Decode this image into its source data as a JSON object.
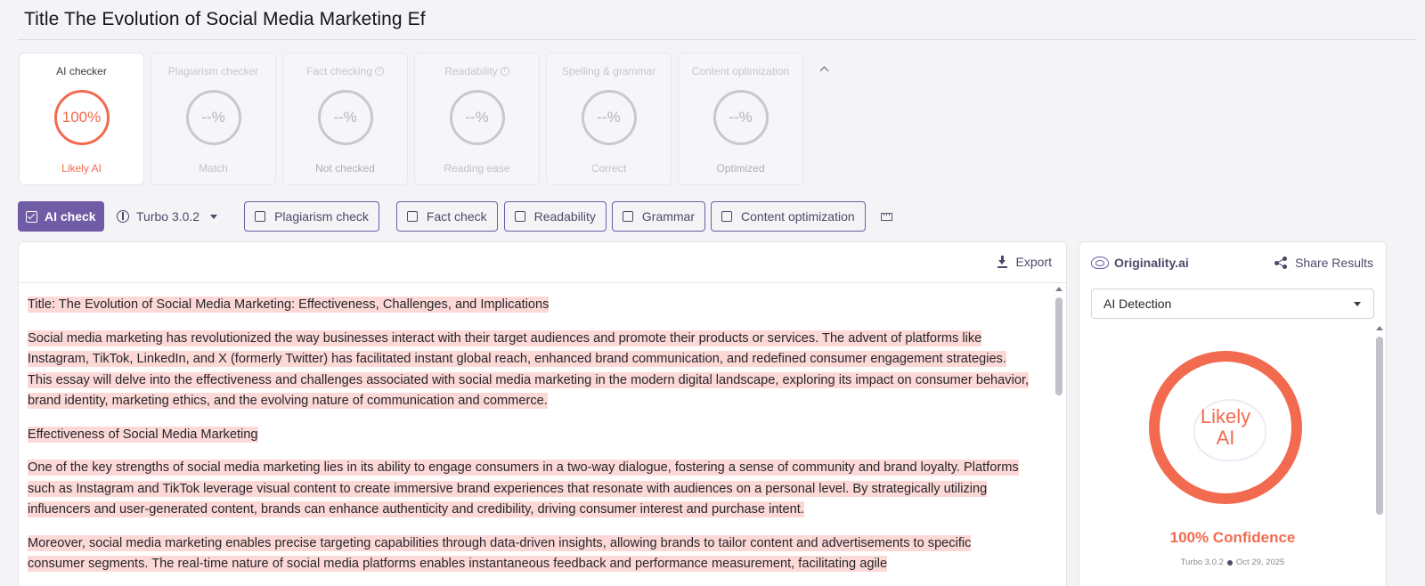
{
  "document": {
    "title": "Title The Evolution of Social Media Marketing Ef"
  },
  "cards": [
    {
      "title": "AI checker",
      "value": "100%",
      "sub": "Likely AI",
      "active": true
    },
    {
      "title": "Plagiarism checker",
      "value": "--%",
      "sub": "Match"
    },
    {
      "title": "Fact checking",
      "value": "--%",
      "sub": "Not checked"
    },
    {
      "title": "Readability",
      "value": "--%",
      "sub": "Reading ease"
    },
    {
      "title": "Spelling & grammar",
      "value": "--%",
      "sub": "Correct"
    },
    {
      "title": "Content optimization",
      "value": "--%",
      "sub": "Optimized"
    }
  ],
  "toolbar": {
    "ai_check": "AI check",
    "model": "Turbo 3.0.2",
    "plagiarism": "Plagiarism check",
    "fact": "Fact check",
    "readability": "Readability",
    "grammar": "Grammar",
    "content_opt": "Content optimization"
  },
  "text_panel": {
    "export": "Export",
    "paragraphs": [
      "Title: The Evolution of Social Media Marketing: Effectiveness, Challenges, and Implications",
      "Social media marketing has revolutionized the way businesses interact with their target audiences and promote their products or services. The advent of platforms like Instagram, TikTok, LinkedIn, and X (formerly Twitter) has facilitated instant global reach, enhanced brand communication, and redefined consumer engagement strategies. This essay will delve into the effectiveness and challenges associated with social media marketing in the modern digital landscape, exploring its impact on consumer behavior, brand identity, marketing ethics, and the evolving nature of communication and commerce.",
      "Effectiveness of Social Media Marketing",
      "One of the key strengths of social media marketing lies in its ability to engage consumers in a two-way dialogue, fostering a sense of community and brand loyalty. Platforms such as Instagram and TikTok leverage visual content to create immersive brand experiences that resonate with audiences on a personal level. By strategically utilizing influencers and user-generated content, brands can enhance authenticity and credibility, driving consumer interest and purchase intent.",
      "Moreover, social media marketing enables precise targeting capabilities through data-driven insights, allowing brands to tailor content and advertisements to specific consumer segments. The real-time nature of social media platforms enables instantaneous feedback and performance measurement, facilitating agile"
    ]
  },
  "side_panel": {
    "brand": "Originality.ai",
    "share": "Share Results",
    "dropdown": "AI Detection",
    "verdict": "Likely AI",
    "confidence": "100% Confidence",
    "model": "Turbo 3.0.2",
    "date": "Oct 29, 2025"
  },
  "colors": {
    "accent": "#6f5ba6",
    "ai_red": "#f26a4f",
    "highlight": "#fcd9d6"
  }
}
